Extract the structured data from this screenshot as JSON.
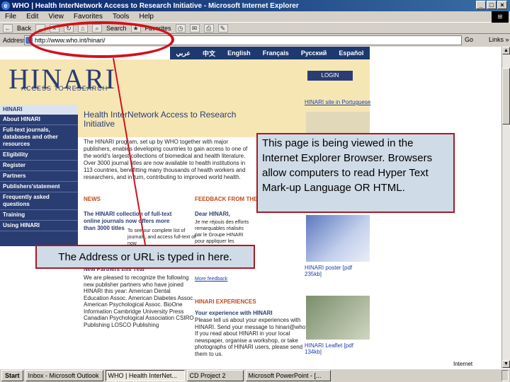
{
  "window": {
    "title": "WHO | Health InterNetwork Access to Research Initiative - Microsoft Internet Explorer"
  },
  "menu": [
    "File",
    "Edit",
    "View",
    "Favorites",
    "Tools",
    "Help"
  ],
  "toolbar": {
    "back_label": "Back",
    "search_label": "Search",
    "favorites_label": "Favorites"
  },
  "address": {
    "label": "Address",
    "value": "http://www.who.int/hinari/",
    "go_label": "Go",
    "links_label": "Links »"
  },
  "page": {
    "languages": [
      "عربي",
      "中文",
      "English",
      "Français",
      "Русский",
      "Español"
    ],
    "logo_text": "HINARI",
    "logo_sub": "ACCESS TO RESEARCH",
    "login_label": "LOGIN",
    "sidebar_head": "HINARI",
    "sidebar_items": [
      "About HINARI",
      "Full-text journals, databases and other resources",
      "Eligibility",
      "Register",
      "Partners",
      "Publishers'statement",
      "Frequently asked questions",
      "Training",
      "Using HINARI"
    ],
    "main_title": "Health InterNetwork Access to Research Initiative",
    "main_intro": "The HINARI program, set up by WHO together with major publishers, enables developing countries to gain access to one of the world's largest collections of biomedical and health literature. Over 3000 journal titles are now available to health institutions in 113 countries, benefitting many thousands of health workers and researchers, and in turn, contributing to improved world health.",
    "news_head": "NEWS",
    "news_h1": "The HINARI collection of full-text online journals now offers more than 3000 titles",
    "news_text": "To see our complete list of journals, and access full-text of now",
    "news_h2": "New Partners this Year",
    "news_list": "We are pleased to recognize the following new publisher partners who have joined HINARI this year: American Dental Education Assoc. American Diabetes Assoc. American Psychological Assoc. BioOne Information Cambridge University Press Canadian Psychological Association CSIRO Publishing LOSCO Publishing",
    "fb_head": "FEEDBACK FROM THE",
    "fb_h1": "Dear HINARI,",
    "fb_text": "Je me réjouis des efforts remarquables réalisés par le Groupe HINARI pour appliquer les objectifs de développement à l'accès à l'information ... travail de ... Novembre 2005",
    "fb_link": "More feedback",
    "exp_head": "HINARI EXPERIENCES",
    "exp_h1": "Your experience with HINARI",
    "exp_text": "Please tell us about your experiences with HINARI. Send your message to hinari@who.int. If you read about HINARI in your local newspaper, organise a workshop, or take photographs of HINARI users, please send them to us.",
    "exp_link": "hinari@who.int",
    "site_link": "HINARI site in Portuguese",
    "poster_link": "HINARI poster [pdf 235kb]",
    "leaflet_link": "HINARI Leaflet [pdf 134kb]"
  },
  "callouts": {
    "browser": "This page is being viewed in the Internet Explorer Browser. Browsers allow computers to read Hyper Text Mark-up Language OR HTML.",
    "address": "The Address or URL is typed in here."
  },
  "status": {
    "zone": "Internet"
  },
  "taskbar": {
    "start_label": "Start",
    "tasks": [
      "Inbox - Microsoft Outlook",
      "WHO | Health InterNet...",
      "CD Project 2",
      "Microsoft PowerPoint - [...",
      ""
    ],
    "time": ""
  }
}
